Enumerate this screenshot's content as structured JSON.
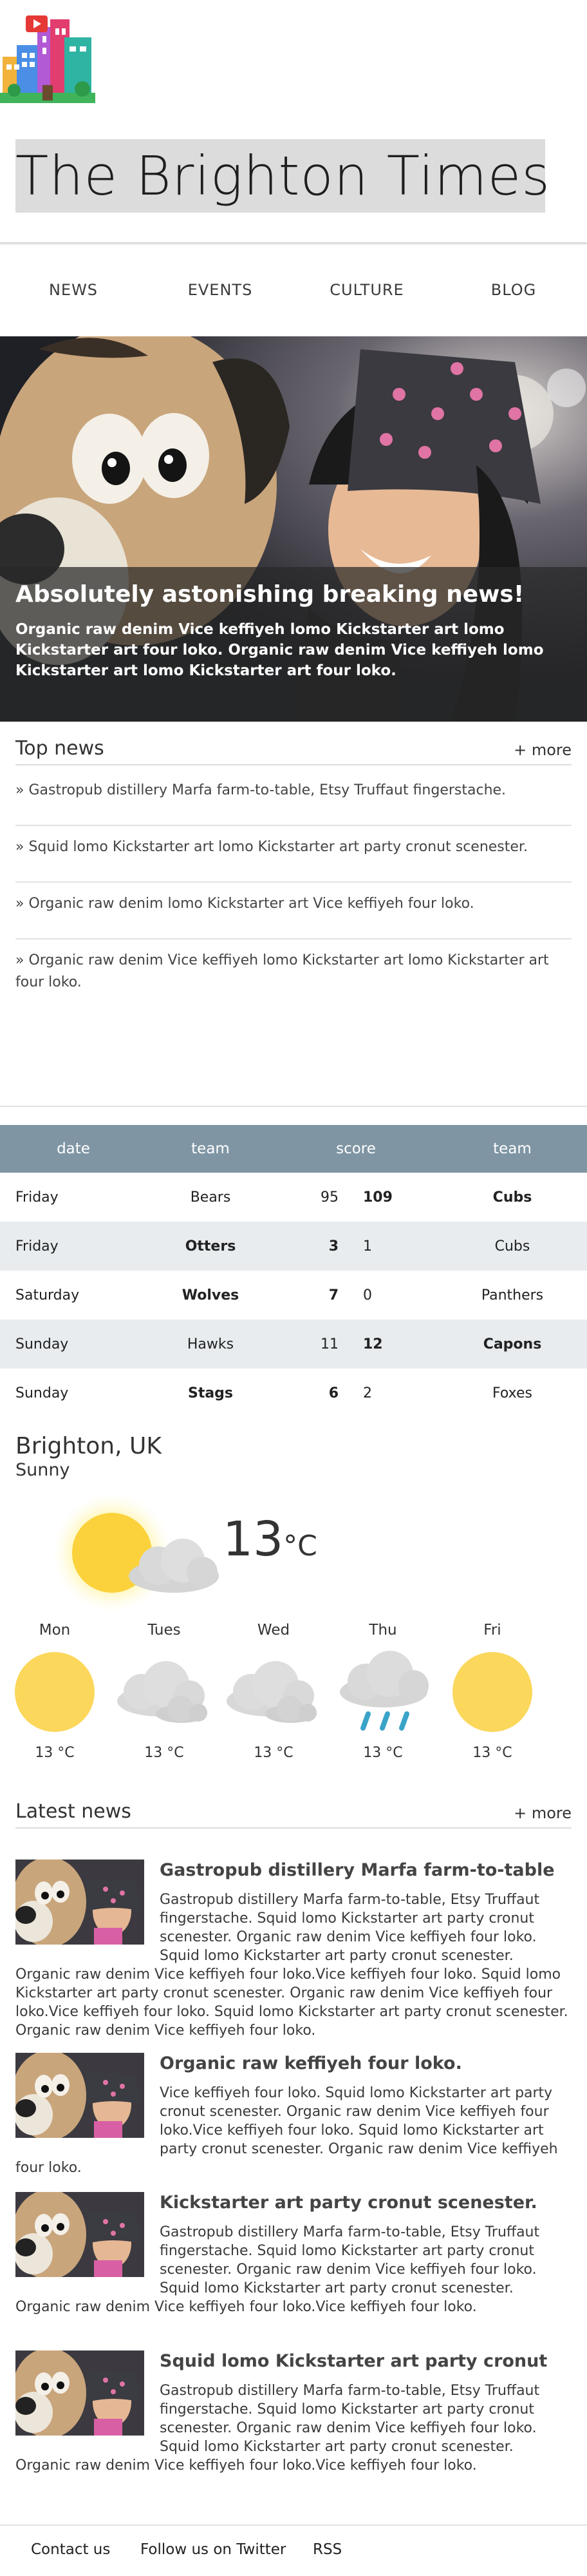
{
  "site": {
    "title": "The Brighton Times",
    "logo_icon": "city-buildings-icon"
  },
  "nav": [
    "NEWS",
    "EVENTS",
    "CULTURE",
    "BLOG"
  ],
  "hero": {
    "headline": "Absolutely astonishing breaking news!",
    "text": "Organic raw denim Vice keffiyeh lomo Kickstarter art lomo Kickstarter art four loko. Organic raw denim Vice keffiyeh lomo Kickstarter art lomo Kickstarter art four loko."
  },
  "top_news": {
    "title": "Top news",
    "more": "+ more",
    "items": [
      "» Gastropub distillery Marfa farm-to-table, Etsy Truffaut fingerstache.",
      "» Squid lomo Kickstarter art lomo Kickstarter art party cronut scenester.",
      "» Organic raw denim lomo Kickstarter art Vice keffiyeh four loko.",
      "» Organic raw denim Vice keffiyeh lomo Kickstarter art lomo Kickstarter art four loko."
    ]
  },
  "scores": {
    "headers": [
      "date",
      "team",
      "score",
      "team"
    ],
    "rows": [
      {
        "date": "Friday",
        "home": "Bears",
        "home_score": "95",
        "away_score": "109",
        "away": "Cubs",
        "winner": "away"
      },
      {
        "date": "Friday",
        "home": "Otters",
        "home_score": "3",
        "away_score": "1",
        "away": "Cubs",
        "winner": "home"
      },
      {
        "date": "Saturday",
        "home": "Wolves",
        "home_score": "7",
        "away_score": "0",
        "away": "Panthers",
        "winner": "home"
      },
      {
        "date": "Sunday",
        "home": "Hawks",
        "home_score": "11",
        "away_score": "12",
        "away": "Capons",
        "winner": "away"
      },
      {
        "date": "Sunday",
        "home": "Stags",
        "home_score": "6",
        "away_score": "2",
        "away": "Foxes",
        "winner": "home"
      }
    ]
  },
  "weather": {
    "city": "Brighton, UK",
    "condition": "Sunny",
    "current_temp": "13",
    "unit": "°C",
    "current_icon": "sun-behind-cloud-icon",
    "days": [
      {
        "day": "Mon",
        "icon": "sun-icon",
        "temp": "13 °C"
      },
      {
        "day": "Tues",
        "icon": "clouds-icon",
        "temp": "13 °C"
      },
      {
        "day": "Wed",
        "icon": "clouds-icon",
        "temp": "13 °C"
      },
      {
        "day": "Thu",
        "icon": "rain-icon",
        "temp": "13 °C"
      },
      {
        "day": "Fri",
        "icon": "sun-icon",
        "temp": "13 °C"
      }
    ]
  },
  "latest_news": {
    "title": "Latest news",
    "more": "+ more",
    "articles": [
      {
        "title": "Gastropub distillery Marfa farm-to-table",
        "body": "Gastropub distillery Marfa farm-to-table, Etsy Truffaut fingerstache. Squid lomo Kickstarter art party cronut scenester. Organic raw denim Vice keffiyeh four loko. Squid lomo Kickstarter art party cronut scenester. Organic raw denim Vice keffiyeh four loko.Vice keffiyeh four loko. Squid lomo Kickstarter art party cronut scenester. Organic raw denim Vice keffiyeh four loko.Vice keffiyeh four loko. Squid lomo Kickstarter art party cronut scenester. Organic raw denim Vice keffiyeh four loko."
      },
      {
        "title": "Organic raw keffiyeh four loko.",
        "body": "Vice keffiyeh four loko. Squid lomo Kickstarter art party cronut scenester. Organic raw denim Vice keffiyeh four loko.Vice keffiyeh four loko. Squid lomo Kickstarter art party cronut scenester. Organic raw denim Vice keffiyeh four loko."
      },
      {
        "title": "Kickstarter art party cronut scenester.",
        "body": "Gastropub distillery Marfa farm-to-table, Etsy Truffaut fingerstache. Squid lomo Kickstarter art party cronut scenester. Organic raw denim Vice keffiyeh four loko. Squid lomo Kickstarter art party cronut scenester. Organic raw denim Vice keffiyeh four loko.Vice keffiyeh four loko."
      },
      {
        "title": "Squid lomo Kickstarter art party cronut",
        "body": "Gastropub distillery Marfa farm-to-table, Etsy Truffaut fingerstache. Squid lomo Kickstarter art party cronut scenester. Organic raw denim Vice keffiyeh four loko. Squid lomo Kickstarter art party cronut scenester. Organic raw denim Vice keffiyeh four loko.Vice keffiyeh four loko."
      }
    ]
  },
  "footer": {
    "contact": "Contact us",
    "twitter": "Follow us on Twitter",
    "rss": "RSS"
  },
  "colors": {
    "table_header": "#7f95a3",
    "table_stripe": "#e8ecef",
    "sun": "#fbd75b",
    "rain": "#3aa3c8"
  }
}
